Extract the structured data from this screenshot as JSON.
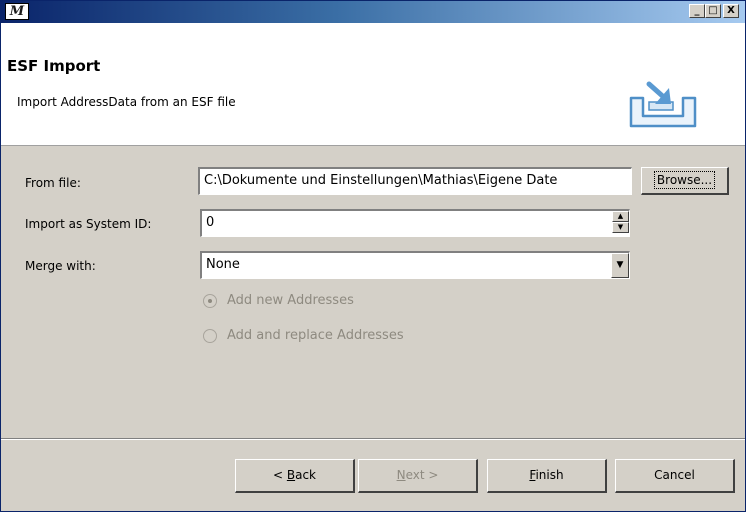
{
  "window": {
    "app_logo": "M",
    "controls": {
      "minimize": "_",
      "maximize": "□",
      "close": "X"
    }
  },
  "banner": {
    "title": "ESF Import",
    "description": "Import AddressData from an ESF file",
    "icon": "import-tray-icon"
  },
  "form": {
    "from_file": {
      "label": "From file:",
      "value": "C:\\Dokumente und Einstellungen\\Mathias\\Eigene Date",
      "browse_label": "Browse..."
    },
    "system_id": {
      "label": "Import as System ID:",
      "value": "0"
    },
    "merge_with": {
      "label": "Merge with:",
      "value": "None"
    },
    "options": [
      {
        "label": "Add new Addresses",
        "selected": true,
        "enabled": false
      },
      {
        "label": "Add and replace Addresses",
        "selected": false,
        "enabled": false
      }
    ]
  },
  "buttons": {
    "back": {
      "prefix": "< ",
      "mnemonic": "B",
      "rest": "ack",
      "enabled": true
    },
    "next": {
      "prefix": "",
      "mnemonic": "N",
      "rest": "ext >",
      "enabled": false
    },
    "finish": {
      "prefix": "",
      "mnemonic": "F",
      "rest": "inish",
      "enabled": true
    },
    "cancel": {
      "label": "Cancel",
      "enabled": true
    }
  },
  "colors": {
    "title_bar_start": "#0a246a",
    "title_bar_end": "#a6caf0",
    "dialog_bg": "#d4d0c8",
    "disabled_text": "#8e8a80"
  }
}
